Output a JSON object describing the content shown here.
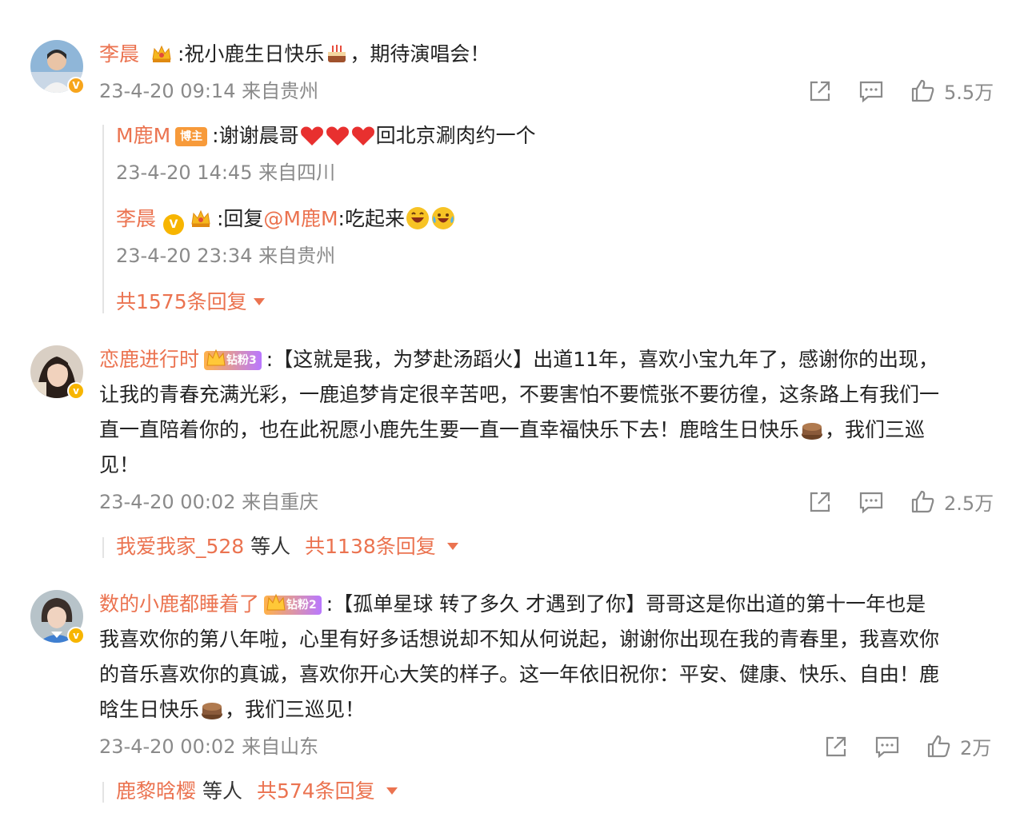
{
  "comments": [
    {
      "user": "李晨",
      "text_a": ":祝小鹿生日快乐",
      "text_b": "，期待演唱会！",
      "time": "23-4-20 09:14 来自贵州",
      "likes": "5.5万",
      "replies": [
        {
          "user": "M鹿M",
          "tag": "博主",
          "text_a": ":谢谢晨哥",
          "text_b": "回北京涮肉约一个",
          "time": "23-4-20 14:45 来自四川"
        },
        {
          "user": "李晨",
          "text_a": ":回复",
          "mention": "@M鹿M",
          "text_b": ":吃起来",
          "time": "23-4-20 23:34 来自贵州"
        }
      ],
      "reply_total": "共1575条回复"
    },
    {
      "user": "恋鹿进行时",
      "fan_badge": "钻粉3",
      "line1": ":【这就是我，为梦赴汤蹈火】出道11年，喜欢小宝九年了，感谢你的出现，",
      "line2": "让我的青春充满光彩，一鹿追梦肯定很辛苦吧，不要害怕不要慌张不要彷徨，这条路上有我们一",
      "line3_a": "直一直陪着你的，也在此祝愿小鹿先生要一直一直幸福快乐下去！鹿晗生日快乐",
      "line3_b": "，我们三巡",
      "line4": "见！",
      "time": "23-4-20 00:02 来自重庆",
      "likes": "2.5万",
      "reply_user": "我爱我家_528",
      "reply_mid": "等人",
      "reply_total": "共1138条回复"
    },
    {
      "user": "数的小鹿都睡着了",
      "fan_badge": "钻粉2",
      "line1": ":【孤单星球 转了多久 才遇到了你】哥哥这是你出道的第十一年也是",
      "line2": "我喜欢你的第八年啦，心里有好多话想说却不知从何说起，谢谢你出现在我的青春里，我喜欢你",
      "line3": "的音乐喜欢你的真诚，喜欢你开心大笑的样子。这一年依旧祝你：平安、健康、快乐、自由！鹿",
      "line4_a": "晗生日快乐",
      "line4_b": "，我们三巡见！",
      "time": "23-4-20 00:02 来自山东",
      "likes": "2万",
      "reply_user": "鹿黎晗樱",
      "reply_mid": "等人",
      "reply_total": "共574条回复"
    }
  ],
  "colors": {
    "username": "#eb7350",
    "meta": "#8a8a8a",
    "text": "#222222"
  },
  "icons": [
    "share-icon",
    "comment-icon",
    "like-icon",
    "crown-icon",
    "verified-badge",
    "heart-icon",
    "cake-emoji",
    "laugh-emoji",
    "caret-down-icon"
  ]
}
